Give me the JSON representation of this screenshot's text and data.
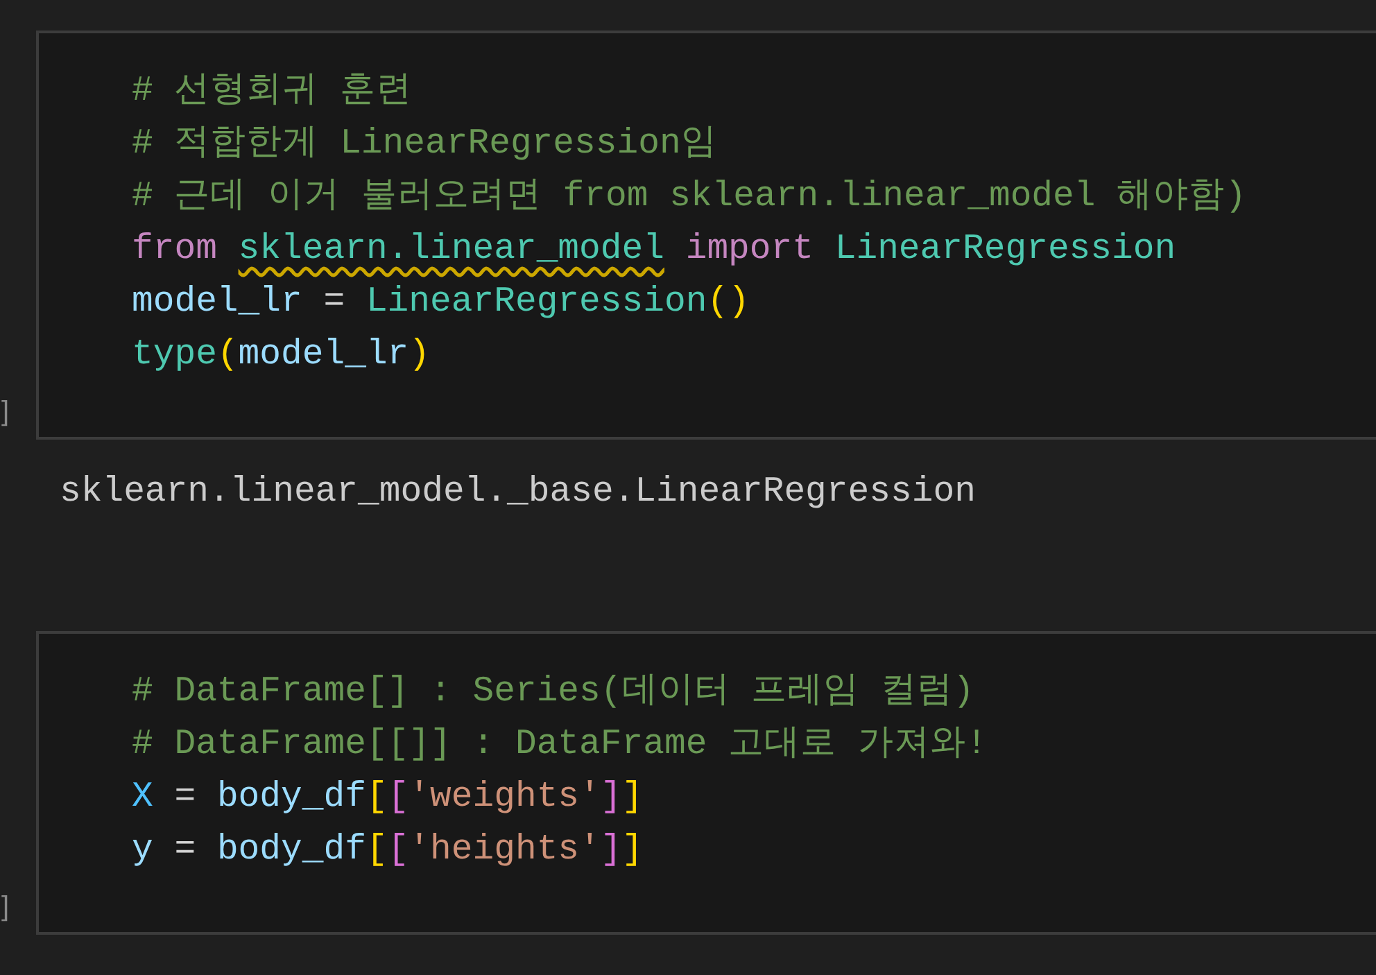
{
  "cells": [
    {
      "gutter": "]",
      "lines": [
        [
          {
            "kind": "comment",
            "text": "# 선형회귀 훈련",
            "warning": false
          }
        ],
        [
          {
            "kind": "comment",
            "text": "# 적합한게 LinearRegression임",
            "warning": false
          }
        ],
        [
          {
            "kind": "comment",
            "text": "# 근데 이거 불러오려면 from sklearn.linear_model 해야함)",
            "warning": false
          }
        ],
        [
          {
            "kind": "keyword",
            "text": "from ",
            "warning": false
          },
          {
            "kind": "module",
            "text": "sklearn.linear_model",
            "warning": true
          },
          {
            "kind": "keyword",
            "text": " import ",
            "warning": false
          },
          {
            "kind": "class",
            "text": "LinearRegression",
            "warning": false
          }
        ],
        [
          {
            "kind": "variable",
            "text": "model_lr",
            "warning": false
          },
          {
            "kind": "plain",
            "text": " = ",
            "warning": false
          },
          {
            "kind": "class",
            "text": "LinearRegression",
            "warning": false
          },
          {
            "kind": "paren1",
            "text": "()",
            "warning": false
          }
        ],
        [
          {
            "kind": "class",
            "text": "type",
            "warning": false
          },
          {
            "kind": "paren1",
            "text": "(",
            "warning": false
          },
          {
            "kind": "variable",
            "text": "model_lr",
            "warning": false
          },
          {
            "kind": "paren1",
            "text": ")",
            "warning": false
          }
        ]
      ],
      "output": "sklearn.linear_model._base.LinearRegression"
    },
    {
      "gutter": "]",
      "lines": [
        [
          {
            "kind": "comment",
            "text": "# DataFrame[] : Series(데이터 프레임 컬럼)",
            "warning": false
          }
        ],
        [
          {
            "kind": "comment",
            "text": "# DataFrame[[]] : DataFrame 고대로 가져와!",
            "warning": false
          }
        ],
        [
          {
            "kind": "constant",
            "text": "X",
            "warning": false
          },
          {
            "kind": "plain",
            "text": " = ",
            "warning": false
          },
          {
            "kind": "variable",
            "text": "body_df",
            "warning": false
          },
          {
            "kind": "paren1",
            "text": "[",
            "warning": false
          },
          {
            "kind": "paren2",
            "text": "[",
            "warning": false
          },
          {
            "kind": "string",
            "text": "'weights'",
            "warning": false
          },
          {
            "kind": "paren2",
            "text": "]",
            "warning": false
          },
          {
            "kind": "paren1",
            "text": "]",
            "warning": false
          }
        ],
        [
          {
            "kind": "variable",
            "text": "y",
            "warning": false
          },
          {
            "kind": "plain",
            "text": " = ",
            "warning": false
          },
          {
            "kind": "variable",
            "text": "body_df",
            "warning": false
          },
          {
            "kind": "paren1",
            "text": "[",
            "warning": false
          },
          {
            "kind": "paren2",
            "text": "[",
            "warning": false
          },
          {
            "kind": "string",
            "text": "'heights'",
            "warning": false
          },
          {
            "kind": "paren2",
            "text": "]",
            "warning": false
          },
          {
            "kind": "paren1",
            "text": "]",
            "warning": false
          }
        ]
      ]
    }
  ]
}
